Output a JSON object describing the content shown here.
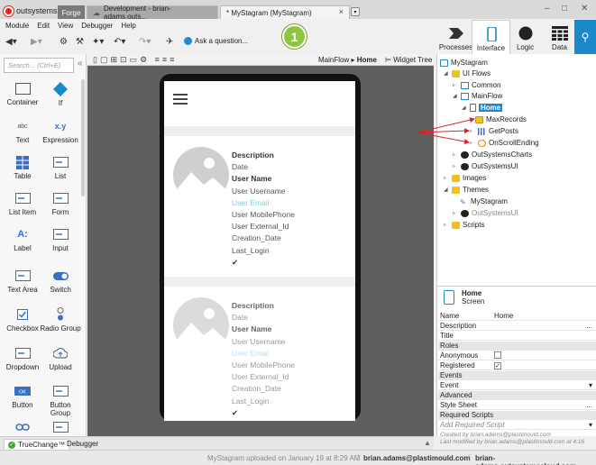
{
  "title_bar": {
    "logo_text": "outsystems",
    "tabs": [
      {
        "label": "Forge"
      },
      {
        "label": "Development - brian-adams.outs..."
      },
      {
        "label": "* MyStagram (MyStagram)"
      }
    ],
    "close_glyph": "×",
    "window_controls": [
      "–",
      "□",
      "✕"
    ]
  },
  "menu": [
    "Module",
    "Edit",
    "View",
    "Debugger",
    "Help"
  ],
  "toolbar": {
    "ask_label": "Ask a question...",
    "step_badge": "1"
  },
  "modes": [
    {
      "label": "Processes",
      "icon": "processes-icon"
    },
    {
      "label": "Interface",
      "icon": "interface-icon",
      "active": true
    },
    {
      "label": "Logic",
      "icon": "logic-icon"
    },
    {
      "label": "Data",
      "icon": "data-icon"
    }
  ],
  "toolbox": {
    "search_placeholder": "Search... (Ctrl+E)",
    "widgets": [
      {
        "label": "Container",
        "icon": "container-icon"
      },
      {
        "label": "If",
        "icon": "if-icon"
      },
      {
        "label": "Text",
        "icon": "text-icon",
        "glyph": "abc"
      },
      {
        "label": "Expression",
        "icon": "expression-icon",
        "glyph": "x.y"
      },
      {
        "label": "Table",
        "icon": "table-icon"
      },
      {
        "label": "List",
        "icon": "list-icon"
      },
      {
        "label": "List Item",
        "icon": "list-item-icon"
      },
      {
        "label": "Form",
        "icon": "form-icon"
      },
      {
        "label": "Label",
        "icon": "label-icon",
        "glyph": "A:"
      },
      {
        "label": "Input",
        "icon": "input-icon"
      },
      {
        "label": "Text Area",
        "icon": "text-area-icon"
      },
      {
        "label": "Switch",
        "icon": "switch-icon"
      },
      {
        "label": "Checkbox",
        "icon": "checkbox-icon"
      },
      {
        "label": "Radio Group",
        "icon": "radio-group-icon"
      },
      {
        "label": "Dropdown",
        "icon": "dropdown-icon"
      },
      {
        "label": "Upload",
        "icon": "upload-icon"
      },
      {
        "label": "Button",
        "icon": "button-icon",
        "glyph": "OK"
      },
      {
        "label": "Button Group",
        "icon": "button-group-icon"
      },
      {
        "label": "",
        "icon": "link-icon"
      },
      {
        "label": "",
        "icon": "popover-icon"
      }
    ]
  },
  "canvas_bar": {
    "flow": "MainFlow",
    "screen": "Home",
    "widget_tree": "Widget Tree"
  },
  "card": {
    "fields": [
      "Description",
      "Date",
      "User Name",
      "User Username",
      "User Email",
      "User MobilePhone",
      "User External_Id",
      "Creation_Date",
      "Last_Login"
    ]
  },
  "tree": {
    "root": "MyStagram",
    "ui_flows": "UI Flows",
    "common": "Common",
    "main_flow": "MainFlow",
    "home": "Home",
    "max_records": "MaxRecords",
    "get_posts": "GetPosts",
    "on_scroll_ending": "OnScrollEnding",
    "os_charts": "OutSystemsCharts",
    "os_ui": "OutSystemsUI",
    "images": "Images",
    "themes": "Themes",
    "theme_mystagram": "MyStagram",
    "theme_osui": "OutSystemsUI",
    "scripts": "Scripts"
  },
  "properties": {
    "header_title": "Home",
    "header_subtitle": "Screen",
    "rows": [
      {
        "k": "Name",
        "v": "Home"
      },
      {
        "k": "Description",
        "v": "..."
      },
      {
        "k": "Title",
        "v": ""
      }
    ],
    "roles": "Roles",
    "anonymous": "Anonymous",
    "registered": "Registered",
    "events": "Events",
    "event": "Event",
    "advanced": "Advanced",
    "style_sheet": "Style Sheet",
    "style_sheet_v": "...",
    "required_scripts": "Required Scripts",
    "add_required_script": "Add Required Script",
    "created_by": "Created by brian.adams@plastimould.com",
    "last_modified": "Last modified by brian.adams@plastimould.com at 4:16"
  },
  "bottom": {
    "truechange": "TrueChange™",
    "debugger": "Debugger"
  },
  "status": {
    "message": "MyStagram uploaded on January 19 at 8:29 AM",
    "user": "brian.adams@plastimould.com",
    "server": "brian-adams.outsystemscloud.com"
  },
  "colors": {
    "accent": "#1a88c9",
    "link": "#7ecbea",
    "annotation_arrow": "#e02020",
    "step_badge": "#8cc63f"
  }
}
